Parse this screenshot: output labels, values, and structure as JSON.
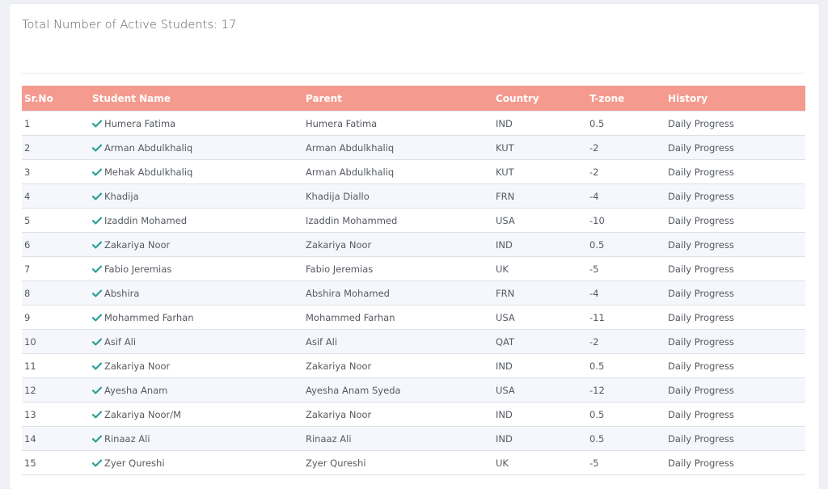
{
  "summary": {
    "label": "Total Number of Active Students: 17"
  },
  "colors": {
    "header_bg": "#f59a8e",
    "check": "#2aa198"
  },
  "table": {
    "columns": [
      "Sr.No",
      "Student Name",
      "Parent",
      "Country",
      "T-zone",
      "History"
    ],
    "rows": [
      {
        "sr": "1",
        "student": "Humera Fatima",
        "parent": "Humera Fatima",
        "country": "IND",
        "tzone": "0.5",
        "history": "Daily Progress"
      },
      {
        "sr": "2",
        "student": "Arman Abdulkhaliq",
        "parent": "Arman Abdulkhaliq",
        "country": "KUT",
        "tzone": "-2",
        "history": "Daily Progress"
      },
      {
        "sr": "3",
        "student": "Mehak Abdulkhaliq",
        "parent": "Arman Abdulkhaliq",
        "country": "KUT",
        "tzone": "-2",
        "history": "Daily Progress"
      },
      {
        "sr": "4",
        "student": "Khadija",
        "parent": "Khadija Diallo",
        "country": "FRN",
        "tzone": "-4",
        "history": "Daily Progress"
      },
      {
        "sr": "5",
        "student": "Izaddin Mohamed",
        "parent": "Izaddin Mohammed",
        "country": "USA",
        "tzone": "-10",
        "history": "Daily Progress"
      },
      {
        "sr": "6",
        "student": "Zakariya Noor",
        "parent": "Zakariya Noor",
        "country": "IND",
        "tzone": "0.5",
        "history": "Daily Progress"
      },
      {
        "sr": "7",
        "student": "Fabio Jeremias",
        "parent": "Fabio Jeremias",
        "country": "UK",
        "tzone": "-5",
        "history": "Daily Progress"
      },
      {
        "sr": "8",
        "student": "Abshira",
        "parent": "Abshira Mohamed",
        "country": "FRN",
        "tzone": "-4",
        "history": "Daily Progress"
      },
      {
        "sr": "9",
        "student": "Mohammed Farhan",
        "parent": "Mohammed Farhan",
        "country": "USA",
        "tzone": "-11",
        "history": "Daily Progress"
      },
      {
        "sr": "10",
        "student": "Asif Ali",
        "parent": "Asif Ali",
        "country": "QAT",
        "tzone": "-2",
        "history": "Daily Progress"
      },
      {
        "sr": "11",
        "student": "Zakariya Noor",
        "parent": "Zakariya Noor",
        "country": "IND",
        "tzone": "0.5",
        "history": "Daily Progress"
      },
      {
        "sr": "12",
        "student": "Ayesha Anam",
        "parent": "Ayesha Anam Syeda",
        "country": "USA",
        "tzone": "-12",
        "history": "Daily Progress"
      },
      {
        "sr": "13",
        "student": "Zakariya Noor/M",
        "parent": "Zakariya Noor",
        "country": "IND",
        "tzone": "0.5",
        "history": "Daily Progress"
      },
      {
        "sr": "14",
        "student": "Rinaaz Ali",
        "parent": "Rinaaz Ali",
        "country": "IND",
        "tzone": "0.5",
        "history": "Daily Progress"
      },
      {
        "sr": "15",
        "student": "Zyer Qureshi",
        "parent": "Zyer Qureshi",
        "country": "UK",
        "tzone": "-5",
        "history": "Daily Progress"
      }
    ]
  }
}
